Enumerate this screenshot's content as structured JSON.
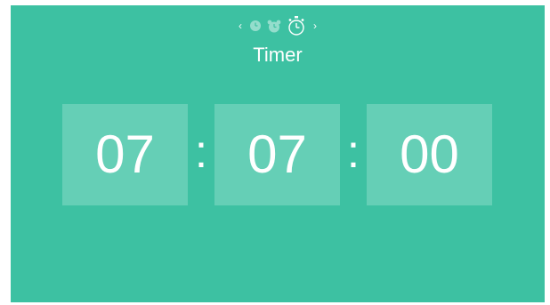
{
  "app": {
    "background_color": "#3dc1a2",
    "tile_color": "#65cfb6"
  },
  "mode_selector": {
    "prev_label": "‹",
    "next_label": "›",
    "modes": [
      "clock-icon",
      "alarm-clock-icon",
      "stopwatch-timer-icon"
    ],
    "active_mode": "stopwatch-timer-icon"
  },
  "title": "Timer",
  "time": {
    "hours": "07",
    "minutes": "07",
    "seconds": "00",
    "separator": ":"
  }
}
